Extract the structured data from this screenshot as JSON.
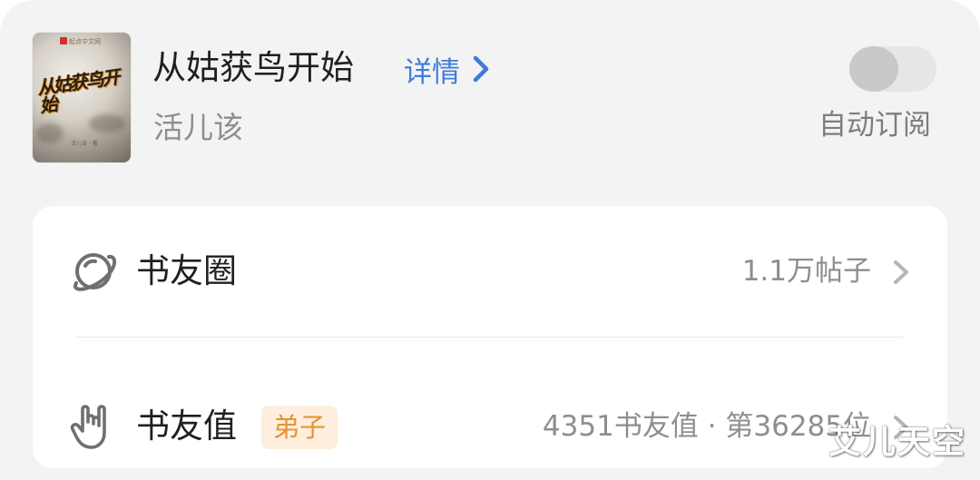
{
  "book": {
    "title": "从姑获鸟开始",
    "details_label": "详情",
    "author": "活儿该",
    "cover": {
      "publisher": "起点中文网",
      "title_art": "从姑获鸟开始",
      "author_line": "活儿该 · 著"
    }
  },
  "auto_subscribe": {
    "label": "自动订阅",
    "enabled": false
  },
  "community": {
    "label": "书友圈",
    "value": "1.1万帖子",
    "icon": "planet-icon"
  },
  "fan_value": {
    "label": "书友值",
    "badge": "弟子",
    "value": "4351书友值 · 第36285位",
    "icon": "rock-hand-icon"
  },
  "watermark": "艾儿天空",
  "colors": {
    "accent_link": "#3f7bd6",
    "badge_bg": "#fdeedd",
    "badge_text": "#e69432",
    "background": "#f3f3f3"
  }
}
